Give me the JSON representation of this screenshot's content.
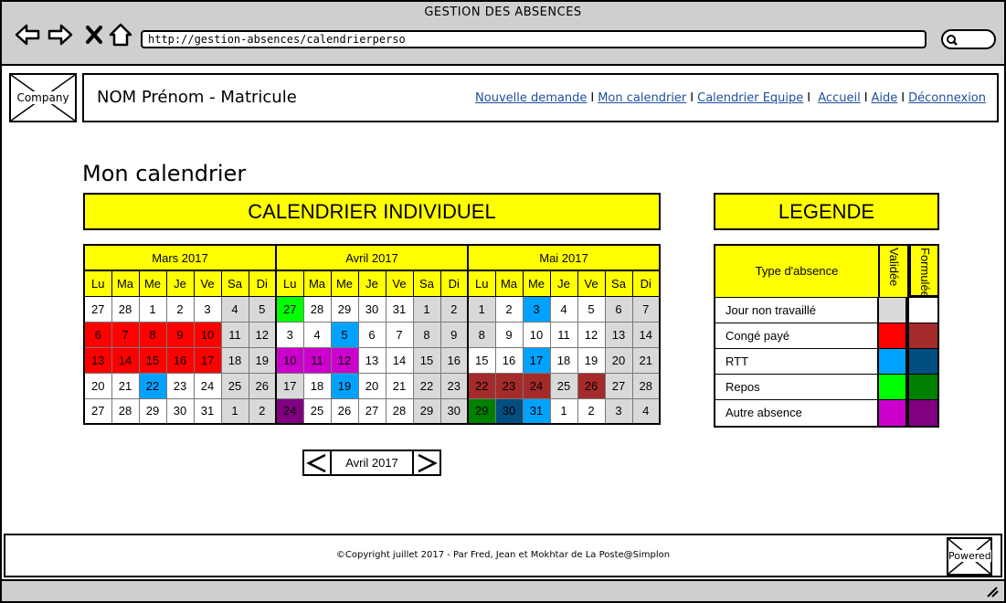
{
  "window": {
    "title": "GESTION DES ABSENCES",
    "url": "http://gestion-absences/calendrierperso"
  },
  "header": {
    "logo_label": "Company",
    "user": "NOM Prénom - Matricule",
    "links": [
      "Nouvelle demande",
      "Mon calendrier",
      "Calendrier Equipe",
      "Accueil",
      "Aide",
      "Déconnexion"
    ]
  },
  "main": {
    "title": "Mon calendrier",
    "calendar_banner": "CALENDRIER INDIVIDUEL",
    "legend_banner": "LEGENDE"
  },
  "calendar": {
    "days": [
      "Lu",
      "Ma",
      "Me",
      "Je",
      "Ve",
      "Sa",
      "Di"
    ],
    "months": [
      {
        "name": "Mars 2017",
        "weeks": [
          [
            {
              "d": "27"
            },
            {
              "d": "28"
            },
            {
              "d": "1"
            },
            {
              "d": "2"
            },
            {
              "d": "3"
            },
            {
              "d": "4",
              "t": "off"
            },
            {
              "d": "5",
              "t": "off"
            }
          ],
          [
            {
              "d": "6",
              "t": "cp_v"
            },
            {
              "d": "7",
              "t": "cp_v"
            },
            {
              "d": "8",
              "t": "cp_v"
            },
            {
              "d": "9",
              "t": "cp_v"
            },
            {
              "d": "10",
              "t": "cp_v"
            },
            {
              "d": "11",
              "t": "off"
            },
            {
              "d": "12",
              "t": "off"
            }
          ],
          [
            {
              "d": "13",
              "t": "cp_v"
            },
            {
              "d": "14",
              "t": "cp_v"
            },
            {
              "d": "15",
              "t": "cp_v"
            },
            {
              "d": "16",
              "t": "cp_v"
            },
            {
              "d": "17",
              "t": "cp_v"
            },
            {
              "d": "18",
              "t": "off"
            },
            {
              "d": "19",
              "t": "off"
            }
          ],
          [
            {
              "d": "20"
            },
            {
              "d": "21"
            },
            {
              "d": "22",
              "t": "rtt_v"
            },
            {
              "d": "23"
            },
            {
              "d": "24"
            },
            {
              "d": "25",
              "t": "off"
            },
            {
              "d": "26",
              "t": "off"
            }
          ],
          [
            {
              "d": "27"
            },
            {
              "d": "28"
            },
            {
              "d": "29"
            },
            {
              "d": "30"
            },
            {
              "d": "31"
            },
            {
              "d": "1",
              "t": "off"
            },
            {
              "d": "2",
              "t": "off"
            }
          ]
        ]
      },
      {
        "name": "Avril 2017",
        "weeks": [
          [
            {
              "d": "27",
              "t": "repos_v"
            },
            {
              "d": "28"
            },
            {
              "d": "29"
            },
            {
              "d": "30"
            },
            {
              "d": "31"
            },
            {
              "d": "1",
              "t": "off"
            },
            {
              "d": "2",
              "t": "off"
            }
          ],
          [
            {
              "d": "3"
            },
            {
              "d": "4"
            },
            {
              "d": "5",
              "t": "rtt_v"
            },
            {
              "d": "6"
            },
            {
              "d": "7"
            },
            {
              "d": "8",
              "t": "off"
            },
            {
              "d": "9",
              "t": "off"
            }
          ],
          [
            {
              "d": "10",
              "t": "autre_v"
            },
            {
              "d": "11",
              "t": "autre_v"
            },
            {
              "d": "12",
              "t": "autre_v"
            },
            {
              "d": "13"
            },
            {
              "d": "14"
            },
            {
              "d": "15",
              "t": "off"
            },
            {
              "d": "16",
              "t": "off"
            }
          ],
          [
            {
              "d": "17",
              "t": "off"
            },
            {
              "d": "18"
            },
            {
              "d": "19",
              "t": "rtt_v"
            },
            {
              "d": "20"
            },
            {
              "d": "21"
            },
            {
              "d": "22",
              "t": "off"
            },
            {
              "d": "23",
              "t": "off"
            }
          ],
          [
            {
              "d": "24",
              "t": "autre_f"
            },
            {
              "d": "25"
            },
            {
              "d": "26"
            },
            {
              "d": "27"
            },
            {
              "d": "28"
            },
            {
              "d": "29",
              "t": "off"
            },
            {
              "d": "30",
              "t": "off"
            }
          ]
        ]
      },
      {
        "name": "Mai 2017",
        "weeks": [
          [
            {
              "d": "1",
              "t": "off"
            },
            {
              "d": "2"
            },
            {
              "d": "3",
              "t": "rtt_v"
            },
            {
              "d": "4"
            },
            {
              "d": "5"
            },
            {
              "d": "6",
              "t": "off"
            },
            {
              "d": "7",
              "t": "off"
            }
          ],
          [
            {
              "d": "8",
              "t": "off"
            },
            {
              "d": "9"
            },
            {
              "d": "10"
            },
            {
              "d": "11"
            },
            {
              "d": "12"
            },
            {
              "d": "13",
              "t": "off"
            },
            {
              "d": "14",
              "t": "off"
            }
          ],
          [
            {
              "d": "15"
            },
            {
              "d": "16"
            },
            {
              "d": "17",
              "t": "rtt_v"
            },
            {
              "d": "18"
            },
            {
              "d": "19"
            },
            {
              "d": "20",
              "t": "off"
            },
            {
              "d": "21",
              "t": "off"
            }
          ],
          [
            {
              "d": "22",
              "t": "cp_f"
            },
            {
              "d": "23",
              "t": "cp_f"
            },
            {
              "d": "24",
              "t": "cp_f"
            },
            {
              "d": "25",
              "t": "off"
            },
            {
              "d": "26",
              "t": "cp_f"
            },
            {
              "d": "27",
              "t": "off"
            },
            {
              "d": "28",
              "t": "off"
            }
          ],
          [
            {
              "d": "29",
              "t": "repos_f"
            },
            {
              "d": "30",
              "t": "rtt_f"
            },
            {
              "d": "31",
              "t": "rtt_v"
            },
            {
              "d": "1"
            },
            {
              "d": "2"
            },
            {
              "d": "3",
              "t": "off"
            },
            {
              "d": "4",
              "t": "off"
            }
          ]
        ]
      }
    ],
    "nav": {
      "current": "Avril 2017"
    }
  },
  "legend": {
    "header_type": "Type d'absence",
    "header_validated": "Validée",
    "header_requested": "Formulée",
    "rows": [
      {
        "label": "Jour non travaillé",
        "validated": "#d9d9d9",
        "requested": ""
      },
      {
        "label": "Congé payé",
        "validated": "#ff0000",
        "requested": "#a52a2a"
      },
      {
        "label": "RTT",
        "validated": "#00a2ff",
        "requested": "#004f80"
      },
      {
        "label": "Repos",
        "validated": "#00ff00",
        "requested": "#008000"
      },
      {
        "label": "Autre absence",
        "validated": "#cc00cc",
        "requested": "#800080"
      }
    ]
  },
  "colors": {
    "off": "#d9d9d9",
    "cp_v": "#ff0000",
    "cp_f": "#a52a2a",
    "rtt_v": "#00a2ff",
    "rtt_f": "#004f80",
    "repos_v": "#00ff00",
    "repos_f": "#008000",
    "autre_v": "#cc00cc",
    "autre_f": "#800080",
    "accent": "#ffff00"
  },
  "footer": {
    "copyright": "©Copyright juillet 2017 - Par Fred, Jean et Mokhtar de La Poste@Simplon",
    "powered_label": "Powered"
  }
}
